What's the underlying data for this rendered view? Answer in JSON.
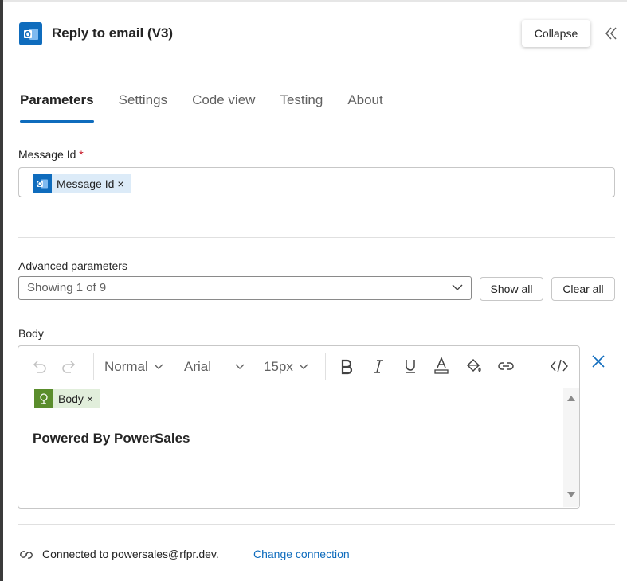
{
  "header": {
    "title": "Reply to email (V3)",
    "collapse_label": "Collapse",
    "app_icon": "outlook-icon",
    "accent_color": "#0f6cbd"
  },
  "tabs": [
    {
      "label": "Parameters",
      "active": true
    },
    {
      "label": "Settings",
      "active": false
    },
    {
      "label": "Code view",
      "active": false
    },
    {
      "label": "Testing",
      "active": false
    },
    {
      "label": "About",
      "active": false
    }
  ],
  "message_id": {
    "label": "Message Id",
    "required_mark": "*",
    "token_label": "Message Id",
    "token_remove": "×"
  },
  "advanced": {
    "label": "Advanced parameters",
    "select_value": "Showing 1 of 9",
    "show_all_label": "Show all",
    "clear_all_label": "Clear all"
  },
  "body": {
    "label": "Body",
    "toolbar": {
      "paragraph_style": "Normal",
      "font_family": "Arial",
      "font_size": "15px"
    },
    "token_label": "Body",
    "token_remove": "×",
    "content_text": "Powered By PowerSales"
  },
  "footer": {
    "connection_text": "Connected to powersales@rfpr.dev.",
    "change_link": "Change connection"
  }
}
